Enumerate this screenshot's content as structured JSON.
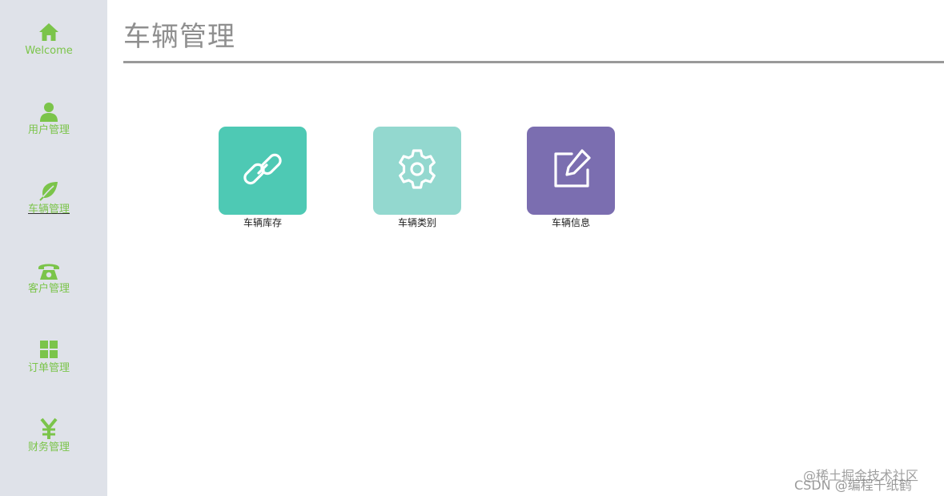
{
  "colors": {
    "sidebar_bg": "#dfe2e9",
    "nav_accent": "#7bc44a",
    "tile_stock": "#4ec9b4",
    "tile_category": "#93d8cf",
    "tile_info": "#7b6eb0"
  },
  "sidebar": {
    "items": [
      {
        "label": "Welcome",
        "icon": "home-icon"
      },
      {
        "label": "用户管理",
        "icon": "user-icon"
      },
      {
        "label": "车辆管理",
        "icon": "leaf-icon",
        "active": true
      },
      {
        "label": "客户管理",
        "icon": "phone-icon"
      },
      {
        "label": "订单管理",
        "icon": "grid-icon"
      },
      {
        "label": "财务管理",
        "icon": "yen-icon"
      }
    ]
  },
  "main": {
    "title": "车辆管理",
    "tiles": [
      {
        "label": "车辆库存",
        "icon": "link-icon"
      },
      {
        "label": "车辆类别",
        "icon": "gear-icon"
      },
      {
        "label": "车辆信息",
        "icon": "edit-icon"
      }
    ]
  },
  "watermark": {
    "line1": "@稀土掘金技术社区",
    "line2": "CSDN @编程千纸鹤"
  }
}
